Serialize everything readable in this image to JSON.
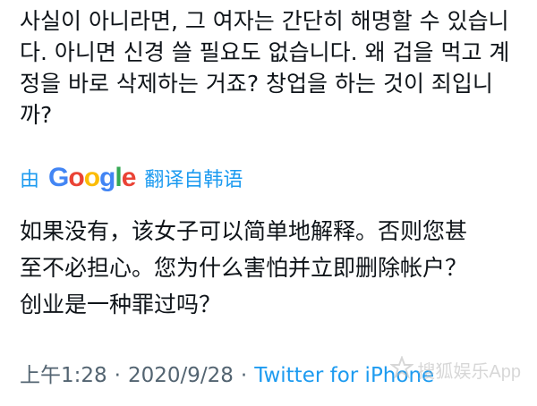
{
  "tweet": {
    "original_text": "사실이 아니라면, 그 여자는 간단히 해명할 수 있습니\n다. 아니면 신경 쓸 필요도 없습니다. 왜 겁을 먹고 계\n정을 바로 삭제하는 거죠? 창업을 하는 것이 죄입니\n까?",
    "translation": {
      "by_label": "由",
      "provider_letters": [
        "G",
        "o",
        "o",
        "g",
        "l",
        "e"
      ],
      "language_label": "翻译自韩语"
    },
    "translated_text": "如果没有，该女子可以简单地解释。否则您甚\n至不必担心。您为什么害怕并立即删除帐户？\n创业是一种罪过吗？",
    "meta": {
      "time": "上午1:28",
      "separator": "·",
      "date": "2020/9/28",
      "source": "Twitter for iPhone"
    }
  },
  "watermark": {
    "icon": "star-logo-icon",
    "text": "搜狐娱乐App",
    "color": "#b8b8b8"
  },
  "colors": {
    "text": "#0f1419",
    "link": "#1d9bf0",
    "muted": "#536471"
  }
}
